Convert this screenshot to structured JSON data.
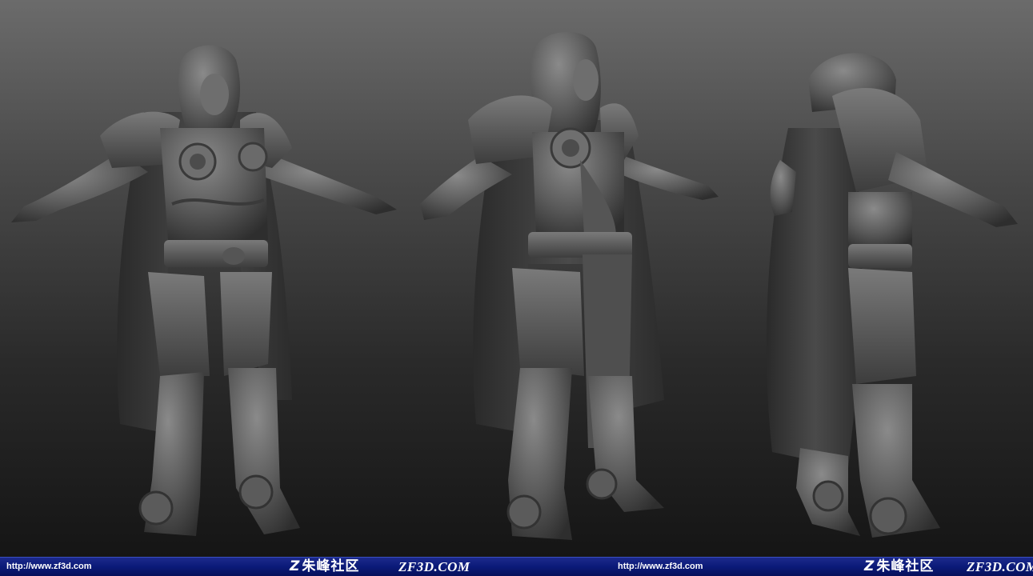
{
  "scene": {
    "description_icons": [
      "hooded-armored-warrior-front-view",
      "hooded-armored-warrior-front-view-cloth",
      "hooded-armored-warrior-back-view"
    ],
    "background_top_color": "#6b6b6b",
    "background_bottom_color": "#151515",
    "model_color": "#5a5a5a"
  },
  "footer": {
    "bar_color": "#0b1a78",
    "left": {
      "url": "http://www.zf3d.com",
      "logo_mark": "Z",
      "logo_text": "朱峰社区",
      "site": "ZF3D.COM"
    },
    "right": {
      "url": "http://www.zf3d.com",
      "logo_mark": "Z",
      "logo_text": "朱峰社区",
      "site": "ZF3D.COM"
    }
  }
}
